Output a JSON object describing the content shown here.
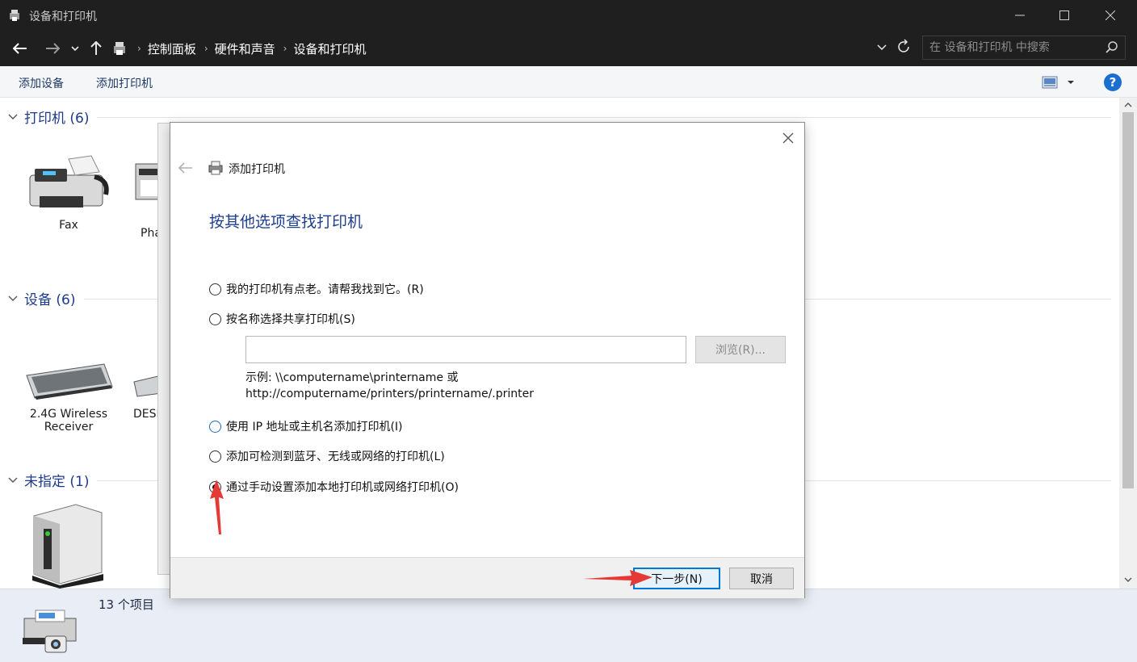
{
  "window": {
    "title": "设备和打印机",
    "minimize_icon": "minimize-icon",
    "maximize_icon": "maximize-icon",
    "close_icon": "close-icon"
  },
  "address": {
    "crumbs": [
      "控制面板",
      "硬件和声音",
      "设备和打印机"
    ],
    "search_placeholder": "在 设备和打印机 中搜索"
  },
  "commands": {
    "add_device": "添加设备",
    "add_printer": "添加打印机"
  },
  "sections": {
    "printers": {
      "label": "打印机 (6)"
    },
    "devices": {
      "label": "设备 (6)"
    },
    "unspecified": {
      "label": "未指定 (1)"
    }
  },
  "items": {
    "fax": "Fax",
    "pha": "Pha",
    "wireless_line1": "2.4G Wireless",
    "wireless_line2": "Receiver",
    "desk": "DESI"
  },
  "status": {
    "count": "13 个项目"
  },
  "dialog": {
    "title": "添加打印机",
    "heading": "按其他选项查找打印机",
    "options": [
      {
        "label": "我的打印机有点老。请帮我找到它。(R)",
        "checked": false
      },
      {
        "label": "按名称选择共享打印机(S)",
        "checked": false
      },
      {
        "label": "使用 IP 地址或主机名添加打印机(I)",
        "checked": false
      },
      {
        "label": "添加可检测到蓝牙、无线或网络的打印机(L)",
        "checked": false
      },
      {
        "label": "通过手动设置添加本地打印机或网络打印机(O)",
        "checked": true
      }
    ],
    "name_value": "",
    "browse_label": "浏览(R)...",
    "example_line1": "示例: \\\\computername\\printername 或",
    "example_line2": "http://computername/printers/printername/.printer",
    "next_label": "下一步(N)",
    "cancel_label": "取消"
  },
  "colors": {
    "accent": "#0078d7",
    "heading": "#1e3f8f",
    "annotation": "#e53935"
  }
}
